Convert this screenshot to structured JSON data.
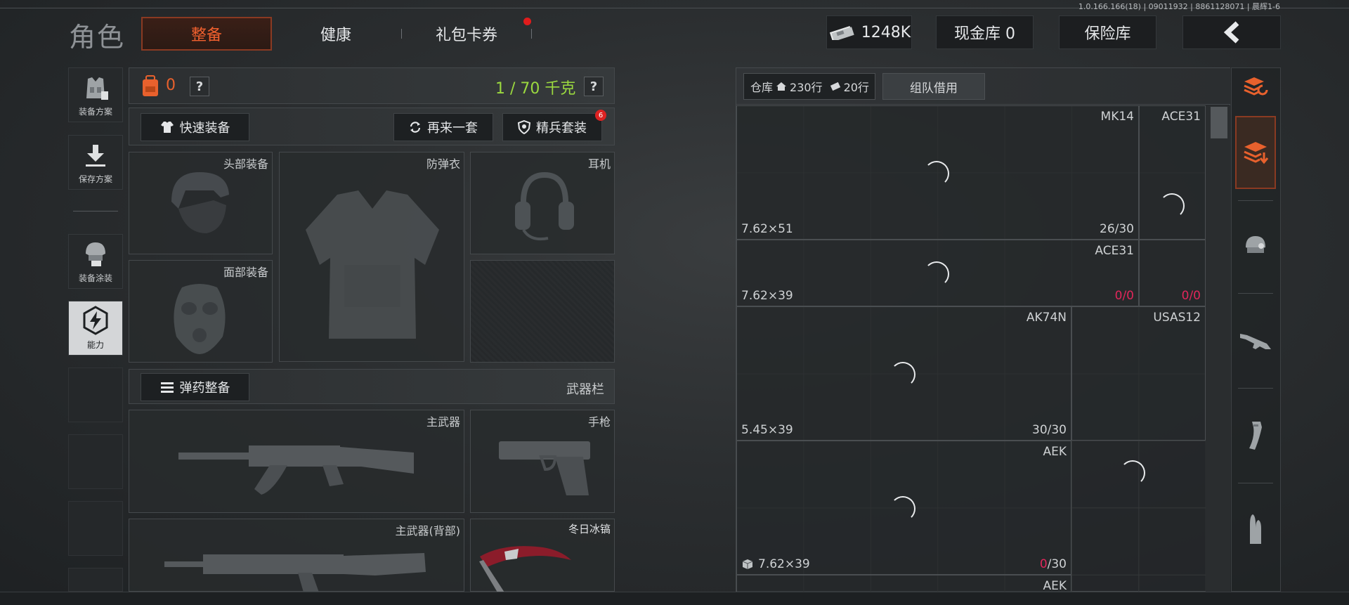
{
  "version": "1.0.166.166(18) | 09011932 | 8861128071 | 晨辉1-6",
  "title": "角色",
  "tabs": [
    {
      "label": "整备",
      "active": true
    },
    {
      "label": "健康",
      "active": false
    },
    {
      "label": "礼包卡券",
      "active": false,
      "notification": true
    }
  ],
  "currency": {
    "icon": "cash-stack-icon",
    "value": "1248K"
  },
  "cash_vault": "现金库 0",
  "safe_box": "保险库",
  "sidebar": [
    {
      "label": "装备方案",
      "icon": "vest-loadout-icon"
    },
    {
      "label": "保存方案",
      "icon": "download-save-icon"
    },
    {
      "label": "装备涂装",
      "icon": "helmet-skin-icon"
    },
    {
      "label": "能力",
      "icon": "ability-bolt-icon",
      "active": true
    }
  ],
  "loadout": {
    "backpack_count": "0",
    "weight": "1 / 70 千克",
    "help": "?",
    "quick_equip": "快速装备",
    "another_set": "再来一套",
    "elite_set": "精兵套装",
    "elite_badge": "6",
    "slots": {
      "head": "头部装备",
      "armor": "防弹衣",
      "headset": "耳机",
      "face": "面部装备"
    },
    "ammo_equip": "弹药整备",
    "weapon_bar": "武器栏",
    "weapons": {
      "primary": "主武器",
      "pistol": "手枪",
      "primary_back": "主武器(背部)",
      "melee": "冬日冰镐"
    }
  },
  "warehouse": {
    "label": "仓库",
    "rows": "230行",
    "extra_rows": "20行",
    "team_borrow": "组队借用",
    "items": [
      {
        "name": "MK14",
        "caliber": "7.62×51",
        "count": "26/30"
      },
      {
        "name": "ACE31",
        "caliber": "",
        "count": ""
      },
      {
        "name": "ACE31",
        "caliber": "7.62×39",
        "count_red": "0",
        "count_rest": "/0"
      },
      {
        "name": "",
        "caliber": "",
        "count_red": "0",
        "count_rest": "/0"
      },
      {
        "name": "AK74N",
        "caliber": "5.45×39",
        "count": "30/30"
      },
      {
        "name": "USAS12",
        "caliber": "",
        "count": ""
      },
      {
        "name": "AEK",
        "caliber": "7.62×39",
        "count_red": "0",
        "count_rest": "/30"
      },
      {
        "name": "AEK",
        "caliber": "",
        "count": ""
      }
    ]
  },
  "right_rail": [
    {
      "icon": "stack-refresh-icon"
    },
    {
      "icon": "stack-download-icon",
      "active": true
    },
    {
      "icon": "helmet-icon"
    },
    {
      "icon": "rifle-icon"
    },
    {
      "icon": "magazine-icon"
    },
    {
      "icon": "ammo-icon"
    }
  ]
}
